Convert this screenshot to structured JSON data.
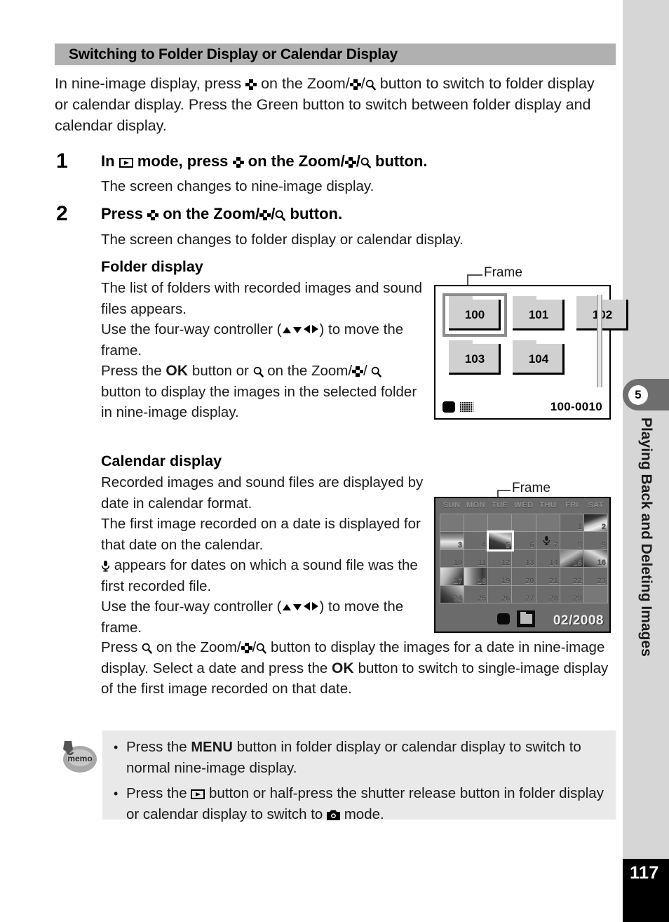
{
  "document": {
    "section_heading": "Switching to Folder Display or Calendar Display",
    "page_number": "117",
    "chapter_number": "5",
    "chapter_title": "Playing Back and Deleting Images"
  },
  "intro": {
    "part1": "In nine-image display, press",
    "part2": "on the Zoom/",
    "part3": "/",
    "part4": "button to switch to folder display or calendar display. Press the Green button to switch between folder display and calendar display."
  },
  "steps": [
    {
      "number": "1",
      "title_part1": "In",
      "title_part2": "mode, press",
      "title_part3": "on the Zoom/",
      "title_part4": "/",
      "title_part5": "button.",
      "body": "The screen changes to nine-image display."
    },
    {
      "number": "2",
      "title_part1": "Press",
      "title_part2": "on the Zoom/",
      "title_part3": "/",
      "title_part4": "button.",
      "body": "The screen changes to folder display or calendar display."
    }
  ],
  "folder_display": {
    "heading": "Folder display",
    "line1": "The list of folders with recorded images and sound files appears.",
    "line2_a": "Use the four-way controller (",
    "line2_b": ") to move the frame.",
    "line3_a": "Press the",
    "line3_b": "button or",
    "line3_c": "on the Zoom/",
    "line3_d": "/",
    "line3_e": "button to display the images in the selected folder in nine-image display.",
    "callout_label": "Frame",
    "screen": {
      "folders": [
        "100",
        "101",
        "102",
        "103",
        "104"
      ],
      "selected_folder": "100",
      "file_number": "100-0010",
      "icons": [
        "card-icon",
        "nine-image-grid-icon"
      ]
    }
  },
  "calendar_display": {
    "heading": "Calendar display",
    "line1": "Recorded images and sound files are displayed by date in calendar format.",
    "line2": "The first image recorded on a date is displayed for that date on the calendar.",
    "line3_a": "appears for dates on which a sound file was the first recorded file.",
    "line4_a": "Use the four-way controller (",
    "line4_b": ") to move the frame.",
    "line5_a": "Press",
    "line5_b": "on the Zoom/",
    "line5_c": "/",
    "line5_d": "button to display the images for a date in nine-image display.",
    "line6_a": "Select a date and press the",
    "line6_b": "button to switch to single-image display of the first image recorded on that date.",
    "callout_label": "Frame",
    "screen": {
      "day_headers": [
        "SUN",
        "MON",
        "TUE",
        "WED",
        "THU",
        "FRI",
        "SAT"
      ],
      "month_label": "02/2008",
      "selected_day": "5",
      "weeks": [
        [
          {
            "day": "",
            "blank": true
          },
          {
            "day": "",
            "blank": true
          },
          {
            "day": "",
            "blank": true
          },
          {
            "day": "",
            "blank": true
          },
          {
            "day": "",
            "blank": true
          },
          {
            "day": "1",
            "thumb": ""
          },
          {
            "day": "2",
            "thumb": "th-b"
          }
        ],
        [
          {
            "day": "3",
            "thumb": "th-a"
          },
          {
            "day": "4",
            "thumb": ""
          },
          {
            "day": "5",
            "thumb": "th-c"
          },
          {
            "day": "6",
            "thumb": ""
          },
          {
            "day": "7",
            "thumb": "",
            "mic": true
          },
          {
            "day": "8",
            "thumb": ""
          },
          {
            "day": "9",
            "thumb": ""
          }
        ],
        [
          {
            "day": "10",
            "thumb": ""
          },
          {
            "day": "11",
            "thumb": ""
          },
          {
            "day": "12",
            "thumb": ""
          },
          {
            "day": "13",
            "thumb": ""
          },
          {
            "day": "14",
            "thumb": ""
          },
          {
            "day": "15",
            "thumb": "th-d"
          },
          {
            "day": "16",
            "thumb": "th-e"
          }
        ],
        [
          {
            "day": "17",
            "thumb": "th-f"
          },
          {
            "day": "18",
            "thumb": "th-g"
          },
          {
            "day": "19",
            "thumb": ""
          },
          {
            "day": "20",
            "thumb": ""
          },
          {
            "day": "21",
            "thumb": ""
          },
          {
            "day": "22",
            "thumb": ""
          },
          {
            "day": "23",
            "thumb": ""
          }
        ],
        [
          {
            "day": "24",
            "thumb": "th-h"
          },
          {
            "day": "25",
            "thumb": ""
          },
          {
            "day": "26",
            "thumb": ""
          },
          {
            "day": "27",
            "thumb": ""
          },
          {
            "day": "28",
            "thumb": ""
          },
          {
            "day": "29",
            "thumb": ""
          },
          {
            "day": "",
            "blank": true
          }
        ]
      ],
      "icons": [
        "card-icon",
        "folder-icon"
      ]
    }
  },
  "memo": {
    "icon_label": "memo",
    "item1_a": "Press the",
    "item1_menu": "MENU",
    "item1_b": "button in folder display or calendar display to switch to normal nine-image display.",
    "item2_a": "Press the",
    "item2_b": "button or half-press the shutter release button in folder display or calendar display to switch to",
    "item2_c": "mode."
  },
  "labels": {
    "ok_button": "OK",
    "menu_button": "MENU"
  },
  "colors": {
    "heading_bar": "#b0b0b0",
    "sidebar": "#d6d6d6",
    "sidebar_tab": "#6e6e6e",
    "memo_bg": "#e9e9e9",
    "lcd_calendar_bg": "#6b6b6b",
    "folder_fill": "#d0d0d0",
    "selection_frame": "#8c8c8c"
  }
}
